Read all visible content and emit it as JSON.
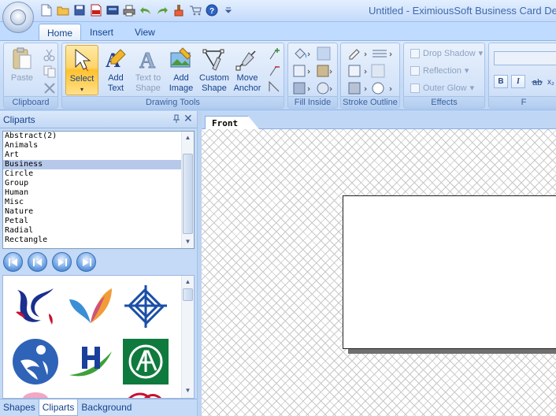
{
  "window": {
    "title": "Untitled - EximiousSoft Business Card Des"
  },
  "quick_access": [
    "new-icon",
    "open-icon",
    "save-icon",
    "pdf-icon",
    "export-icon",
    "print-icon",
    "undo-icon",
    "redo-icon",
    "paint-icon",
    "cart-icon",
    "help-icon",
    "dropdown-icon"
  ],
  "tabs": [
    {
      "label": "Home",
      "active": true
    },
    {
      "label": "Insert",
      "active": false
    },
    {
      "label": "View",
      "active": false
    }
  ],
  "ribbon": {
    "clipboard": {
      "label": "Clipboard",
      "paste": "Paste"
    },
    "drawing_tools": {
      "label": "Drawing Tools",
      "select": "Select",
      "add_text_1": "Add",
      "add_text_2": "Text",
      "text_to_shape_1": "Text to",
      "text_to_shape_2": "Shape",
      "add_image_1": "Add",
      "add_image_2": "Image",
      "custom_shape_1": "Custom",
      "custom_shape_2": "Shape",
      "move_anchor_1": "Move",
      "move_anchor_2": "Anchor"
    },
    "fill_inside": {
      "label": "Fill Inside"
    },
    "stroke_outline": {
      "label": "Stroke Outline"
    },
    "effects": {
      "label": "Effects",
      "drop_shadow": "Drop Shadow",
      "reflection": "Reflection",
      "outer_glow": "Outer Glow"
    },
    "font": {
      "label": "F",
      "bold": "B",
      "italic": "I"
    }
  },
  "cliparts_panel": {
    "title": "Cliparts",
    "categories": [
      "Abstract(2)",
      "Animals",
      "Art",
      "Business",
      "Circle",
      "Group",
      "Human",
      "Misc",
      "Nature",
      "Petal",
      "Radial",
      "Rectangle"
    ],
    "selected_category": "Business",
    "bottom_tabs": [
      {
        "label": "Shapes",
        "active": false
      },
      {
        "label": "Cliparts",
        "active": true
      },
      {
        "label": "Background",
        "active": false
      }
    ],
    "clip_colors": [
      "#1a2f8f",
      "#c8102e",
      "#f29c38",
      "#3a6bd6",
      "#2f8f3a",
      "#0f7a3d"
    ]
  },
  "document": {
    "tab_label": "Front"
  }
}
